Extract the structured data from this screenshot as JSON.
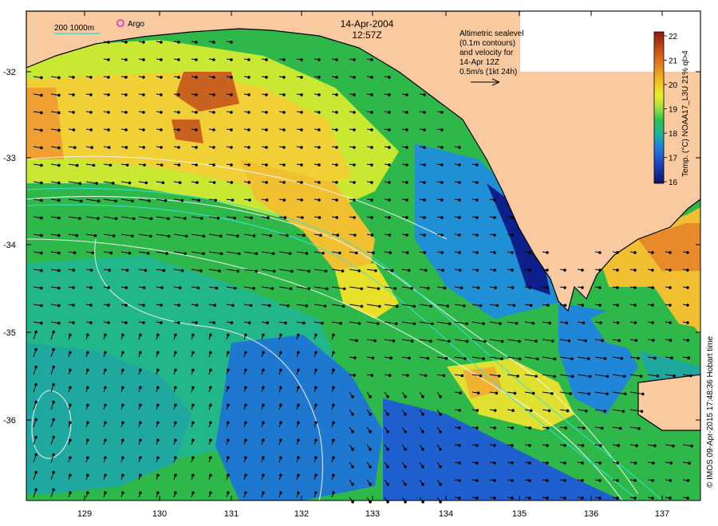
{
  "header": {
    "date": "14-Apr-2004",
    "time": "12:57Z"
  },
  "legend": {
    "depth_contours": "200  1000m",
    "argo": "Argo"
  },
  "annotation": {
    "lines": [
      "Altimetric sealevel",
      "(0.1m contours)",
      "and velocity for",
      "14-Apr 12Z",
      "0.5m/s (1kt 24h)"
    ]
  },
  "colorbar": {
    "label": "Temp. (°C) NOAA17_L3U 21% ql>4",
    "ticks": [
      "22",
      "21",
      "20",
      "19",
      "18",
      "17",
      "16"
    ],
    "min": 16,
    "max": 22
  },
  "axes": {
    "lat_labels": [
      "-32",
      "-33",
      "-34",
      "-35",
      "-36"
    ],
    "lon_labels": [
      "129",
      "130",
      "131",
      "132",
      "133",
      "134",
      "135",
      "136",
      "137"
    ]
  },
  "credit": "© IMOS 09-Apr-2015 17:48:36 Hobart time",
  "colors": {
    "land": "#f9c9a0",
    "warm": "#e8801e",
    "cool": "#1a3fb0"
  }
}
